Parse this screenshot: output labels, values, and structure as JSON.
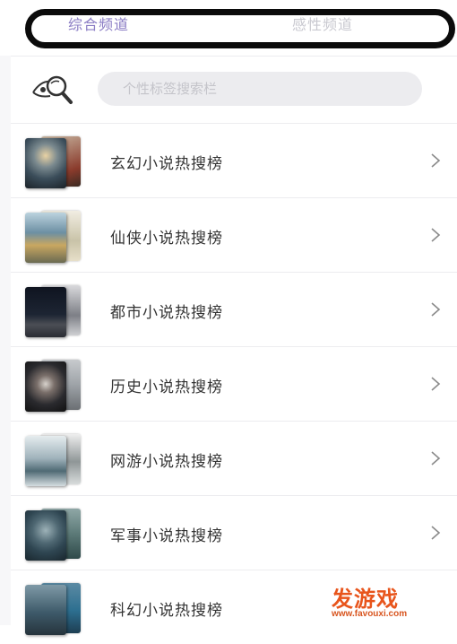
{
  "tabs": {
    "active_label": "综合频道",
    "inactive_label": "感性频道"
  },
  "search": {
    "placeholder": "个性标签搜索栏",
    "icon": "magnifier-eye-icon"
  },
  "rankings": [
    {
      "label": "玄幻小说热搜榜",
      "thumb_colors": [
        "#3b4d5a",
        "#8a3b2c"
      ]
    },
    {
      "label": "仙侠小说热搜榜",
      "thumb_colors": [
        "#6c8fa3",
        "#c9c3a8"
      ]
    },
    {
      "label": "都市小说热搜榜",
      "thumb_colors": [
        "#1d2533",
        "#7d7f86"
      ]
    },
    {
      "label": "历史小说热搜榜",
      "thumb_colors": [
        "#2a2a2e",
        "#9ea3a8"
      ]
    },
    {
      "label": "网游小说热搜榜",
      "thumb_colors": [
        "#9fb2bb",
        "#d8dcdc"
      ]
    },
    {
      "label": "军事小说热搜榜",
      "thumb_colors": [
        "#2f4652",
        "#5c7a78"
      ]
    },
    {
      "label": "科幻小说热搜榜",
      "thumb_colors": [
        "#3e5a6a",
        "#2d6f90"
      ]
    }
  ],
  "watermark": {
    "main": "发游戏",
    "url": "www.favouxi.com"
  },
  "colors": {
    "active_tab": "#8a7cc4",
    "inactive_tab": "#c9c9d0",
    "divider": "#ececef",
    "watermark": "#e8551c"
  }
}
